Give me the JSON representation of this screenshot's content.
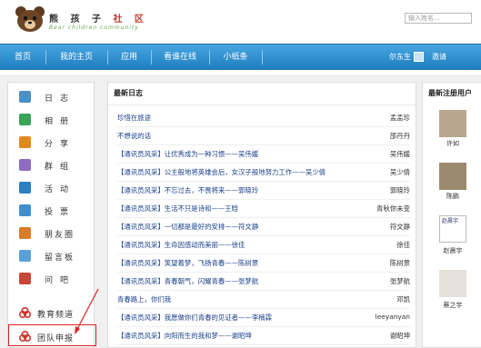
{
  "logo": {
    "cn": "熊 孩 子",
    "cn_red": "社 区",
    "en": "Bear children community"
  },
  "search": {
    "placeholder": "输入姓名..."
  },
  "nav": {
    "items": [
      "首页",
      "我的主页",
      "应用",
      "看谁在线",
      "小纸条"
    ],
    "user": "尔东生",
    "extra": "邀请"
  },
  "sidebar": {
    "items": [
      {
        "label": "日志",
        "icon": "journal-icon",
        "color": "#4a90c8"
      },
      {
        "label": "相册",
        "icon": "photo-album-icon",
        "color": "#3aa35a"
      },
      {
        "label": "分享",
        "icon": "share-icon",
        "color": "#e08a1e"
      },
      {
        "label": "群组",
        "icon": "group-icon",
        "color": "#8e6cc0"
      },
      {
        "label": "活动",
        "icon": "activity-icon",
        "color": "#2d7fc0"
      },
      {
        "label": "投票",
        "icon": "vote-icon",
        "color": "#3f8fd0"
      },
      {
        "label": "朋友圈",
        "icon": "friends-icon",
        "color": "#d97b2a"
      },
      {
        "label": "留言板",
        "icon": "guestbook-icon",
        "color": "#5aa0d8"
      },
      {
        "label": "问吧",
        "icon": "question-icon",
        "color": "#c8453a"
      },
      {
        "label": "教育频道",
        "icon": "education-icon",
        "color": "#d0342c"
      },
      {
        "label": "团队申报",
        "icon": "team-apply-icon",
        "color": "#d0342c"
      }
    ]
  },
  "main": {
    "title": "最新日志",
    "rows": [
      {
        "title": "珍惜在旅途",
        "author": "孟孟珍"
      },
      {
        "title": "不想说的话",
        "author": "邵丹丹"
      },
      {
        "title": "【通讯员风采】让优秀成为一种习惯——吴伟媛",
        "author": "吴伟媛"
      },
      {
        "title": "【通讯员风采】公主般地将英雄会后，女汉子般地努力工作——吴少倩",
        "author": "吴少倩"
      },
      {
        "title": "【通讯员风采】不忘过去，不畏将来——郭晓玲",
        "author": "郭晓玲"
      },
      {
        "title": "【通讯员风采】生活不只是诗和——王晗",
        "author": "青秋你未变"
      },
      {
        "title": "【通讯员风采】一切都是最好的安排——符文静",
        "author": "符文静"
      },
      {
        "title": "【通讯员风采】生命因感动而美丽——徐佳",
        "author": "徐佳"
      },
      {
        "title": "【通讯员风采】笑望着梦，飞扬青春——陈树景",
        "author": "陈树景"
      },
      {
        "title": "【通讯员风采】青春朝气，闪耀青春——张梦航",
        "author": "张梦航"
      },
      {
        "title": "青春路上，你们我",
        "author": "邓凯"
      },
      {
        "title": "【通讯员风采】我愿做你们青春的见证者——李楠霖",
        "author": "leeyanyan"
      },
      {
        "title": "【通讯员风采】向阳而生的我和梦——谢昭坤",
        "author": "谢昭坤"
      }
    ]
  },
  "right": {
    "title": "最新注册用户",
    "users": [
      {
        "name": "许如",
        "broken": false,
        "photo": "#b8a68e"
      },
      {
        "name": "陈鹏",
        "broken": false,
        "photo": "#9c8a6e"
      },
      {
        "name": "赵晨宇",
        "broken": true,
        "alt": "赵晨宇"
      },
      {
        "name": "蔡之宇",
        "broken": false,
        "photo": "#e6e1da"
      }
    ]
  },
  "colors": {
    "nav": "#2f8fcf",
    "highlight": "#e02020",
    "link": "#1a3f8a"
  }
}
